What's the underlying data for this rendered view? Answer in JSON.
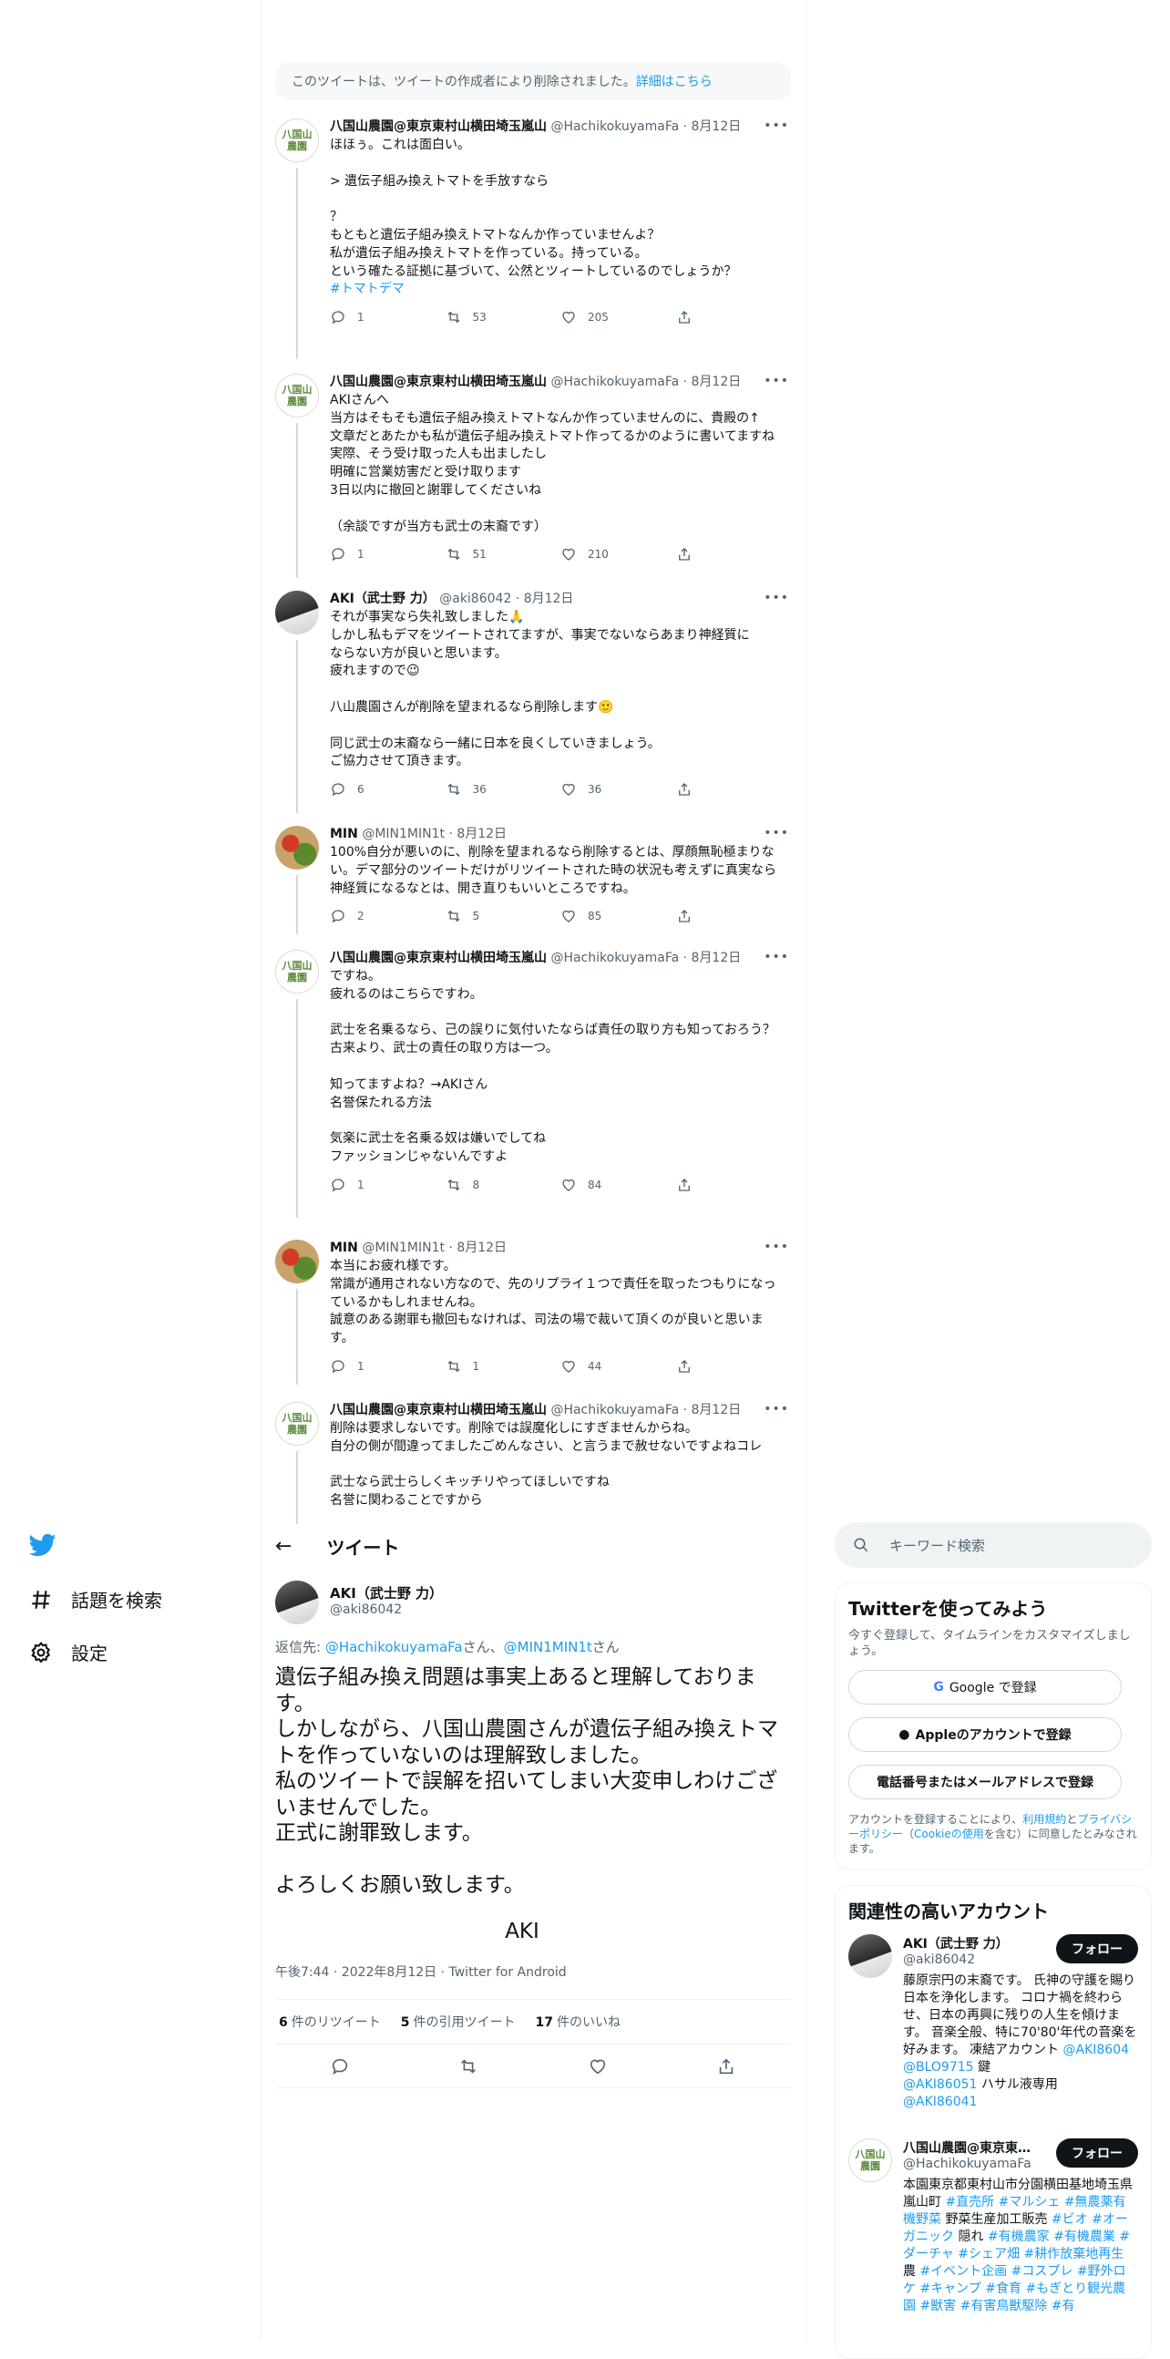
{
  "deleted_notice": {
    "text": "このツイートは、ツイートの作成者により削除されました。",
    "link": "詳細はこちら"
  },
  "thread": [
    {
      "avatar": "farm",
      "name": "八国山農園@東京東村山横田埼玉嵐山",
      "handle": "@HachikokuyamaFa",
      "date": "· 8月12日",
      "text": "ほほぅ。これは面白い。\n\n> 遺伝子組み換えトマトを手放すなら\n\n？\nもともと遺伝子組み換えトマトなんか作っていませんよ？\n私が遺伝子組み換えトマトを作っている。持っている。\nという確たる証拠に基づいて、公然とツィートしているのでしょうか？\n",
      "tag": "#トマトデマ",
      "replies": "1",
      "retweets": "53",
      "likes": "205"
    },
    {
      "avatar": "farm",
      "name": "八国山農園@東京東村山横田埼玉嵐山",
      "handle": "@HachikokuyamaFa",
      "date": "· 8月12日",
      "text": "AKIさんへ\n当方はそもそも遺伝子組み換えトマトなんか作っていませんのに、貴殿の↑\n文章だとあたかも私が遺伝子組み換えトマト作ってるかのように書いてますね\n実際、そう受け取った人も出ましたし\n明確に営業妨害だと受け取ります\n3日以内に撤回と謝罪してくださいね\n\n（余談ですが当方も武士の末裔です）",
      "tag": "",
      "replies": "1",
      "retweets": "51",
      "likes": "210"
    },
    {
      "avatar": "aki",
      "name": "AKI（武士野 力）",
      "handle": "@aki86042",
      "date": "· 8月12日",
      "text": "それが事実なら失礼致しました🙏\nしかし私もデマをツイートされてますが、事実でないならあまり神経質に\nならない方が良いと思います。\n疲れますので😉\n\n八山農園さんが削除を望まれるなら削除します🙂\n\n同じ武士の末裔なら一緒に日本を良くしていきましょう。\nご協力させて頂きます。",
      "tag": "",
      "replies": "6",
      "retweets": "36",
      "likes": "36"
    },
    {
      "avatar": "min",
      "name": "MIN",
      "handle": "@MIN1MIN1t",
      "date": "· 8月12日",
      "text": "100%自分が悪いのに、削除を望まれるなら削除するとは、厚顔無恥極まりない。デマ部分のツイートだけがリツイートされた時の状況も考えずに真実なら神経質になるなとは、開き直りもいいところですね。",
      "tag": "",
      "replies": "2",
      "retweets": "5",
      "likes": "85"
    },
    {
      "avatar": "farm",
      "name": "八国山農園@東京東村山横田埼玉嵐山",
      "handle": "@HachikokuyamaFa",
      "date": "· 8月12日",
      "text": "ですね。\n疲れるのはこちらですわ。\n\n武士を名乗るなら、己の誤りに気付いたならば責任の取り方も知っておろう？\n古来より、武士の責任の取り方は一つ。\n\n知ってますよね？→AKIさん\n名誉保たれる方法\n\n気楽に武士を名乗る奴は嫌いでしてね\nファッションじゃないんですよ",
      "tag": "",
      "replies": "1",
      "retweets": "8",
      "likes": "84"
    },
    {
      "avatar": "min",
      "name": "MIN",
      "handle": "@MIN1MIN1t",
      "date": "· 8月12日",
      "text": "本当にお疲れ様です。\n常識が通用されない方なので、先のリプライ１つで責任を取ったつもりになっているかもしれませんね。\n誠意のある謝罪も撤回もなければ、司法の場で裁いて頂くのが良いと思います。",
      "tag": "",
      "replies": "1",
      "retweets": "1",
      "likes": "44"
    },
    {
      "avatar": "farm",
      "name": "八国山農園@東京東村山横田埼玉嵐山",
      "handle": "@HachikokuyamaFa",
      "date": "· 8月12日",
      "text": "削除は要求しないです。削除では誤魔化しにすぎませんからね。\n自分の側が間違ってましたごめんなさい、と言うまで赦せないですよねコレ\n\n武士なら武士らしくキッチリやってほしいですね\n名誉に関わることですから",
      "tag": "",
      "replies": "",
      "retweets": "",
      "likes": ""
    }
  ],
  "nav": {
    "explore": "話題を検索",
    "settings": "設定"
  },
  "focal": {
    "header": "ツイート",
    "name": "AKI（武士野 力）",
    "handle": "@aki86042",
    "reply_prefix": "返信先: ",
    "reply_user1": "@HachikokuyamaFa",
    "reply_mid": "さん、",
    "reply_user2": "@MIN1MIN1t",
    "reply_suffix": "さん",
    "text": "遺伝子組み換え問題は事実上あると理解しております。\nしかしながら、八国山農園さんが遺伝子組み換えトマトを作っていないのは理解致しました。\n私のツイートで誤解を招いてしまい大変申しわけございませんでした。\n正式に謝罪致します。\n\nよろしくお願い致します。",
    "signature": "AKI",
    "meta": "午後7:44 · 2022年8月12日 · Twitter for Android",
    "retweets": "6",
    "retweets_label": "件のリツイート",
    "quotes": "5",
    "quotes_label": "件の引用ツイート",
    "likes": "17",
    "likes_label": "件のいいね"
  },
  "sidebar": {
    "search_placeholder": "キーワード検索",
    "signup": {
      "title": "Twitterを使ってみよう",
      "subtitle": "今すぐ登録して、タイムラインをカスタマイズしましょう。",
      "google": "Google で登録",
      "apple": "Appleのアカウントで登録",
      "phone": "電話番号またはメールアドレスで登録",
      "terms_prefix": "アカウントを登録することにより、",
      "terms_link1": "利用規約",
      "terms_mid1": "と",
      "terms_link2": "プライバシーポリシー",
      "terms_mid2": "（",
      "terms_link3": "Cookieの使用",
      "terms_suffix": "を含む）に同意したとみなされます。"
    },
    "relevant": {
      "title": "関連性の高いアカウント",
      "follow": "フォロー",
      "accounts": [
        {
          "name": "AKI（武士野 力）",
          "handle": "@aki86042",
          "bio_text": "藤原宗円の末裔です。 氏神の守護を賜り日本を浄化します。 コロナ禍を終わらせ、日本の再興に残りの人生を傾けます。 音楽全般、特に70'80'年代の音楽を好みます。 凍結アカウント ",
          "bio_l1": "@AKI8604",
          "bio_m1": "  ",
          "bio_l2": "@BLO9715",
          "bio_m2": " 鍵",
          "bio_l3": "@AKI86051",
          "bio_m3": " ハサル液専用 ",
          "bio_l4": "@AKI86041"
        },
        {
          "name": "八国山農園@東京東村山横田埼玉嵐山",
          "handle": "@HachikokuyamaFa",
          "bio_text": "本園東京都東村山市分園横田基地埼玉県嵐山町 ",
          "bio_tags": "#直売所 #マルシェ #無農薬有機野菜",
          "bio_m1": " 野菜生産加工販売 ",
          "bio_tags2": "#ビオ #オーガニック",
          "bio_m2": " 隠れ ",
          "bio_tags3": "#有機農家 #有機農業 #ダーチャ #シェア畑 #耕作放棄地再生",
          "bio_m3": " 農 ",
          "bio_tags4": "#イベント企画 #コスプレ #野外ロケ #キャンプ #食育 #もぎとり観光農園 #獣害 #有害鳥獣駆除 #有"
        }
      ]
    }
  }
}
